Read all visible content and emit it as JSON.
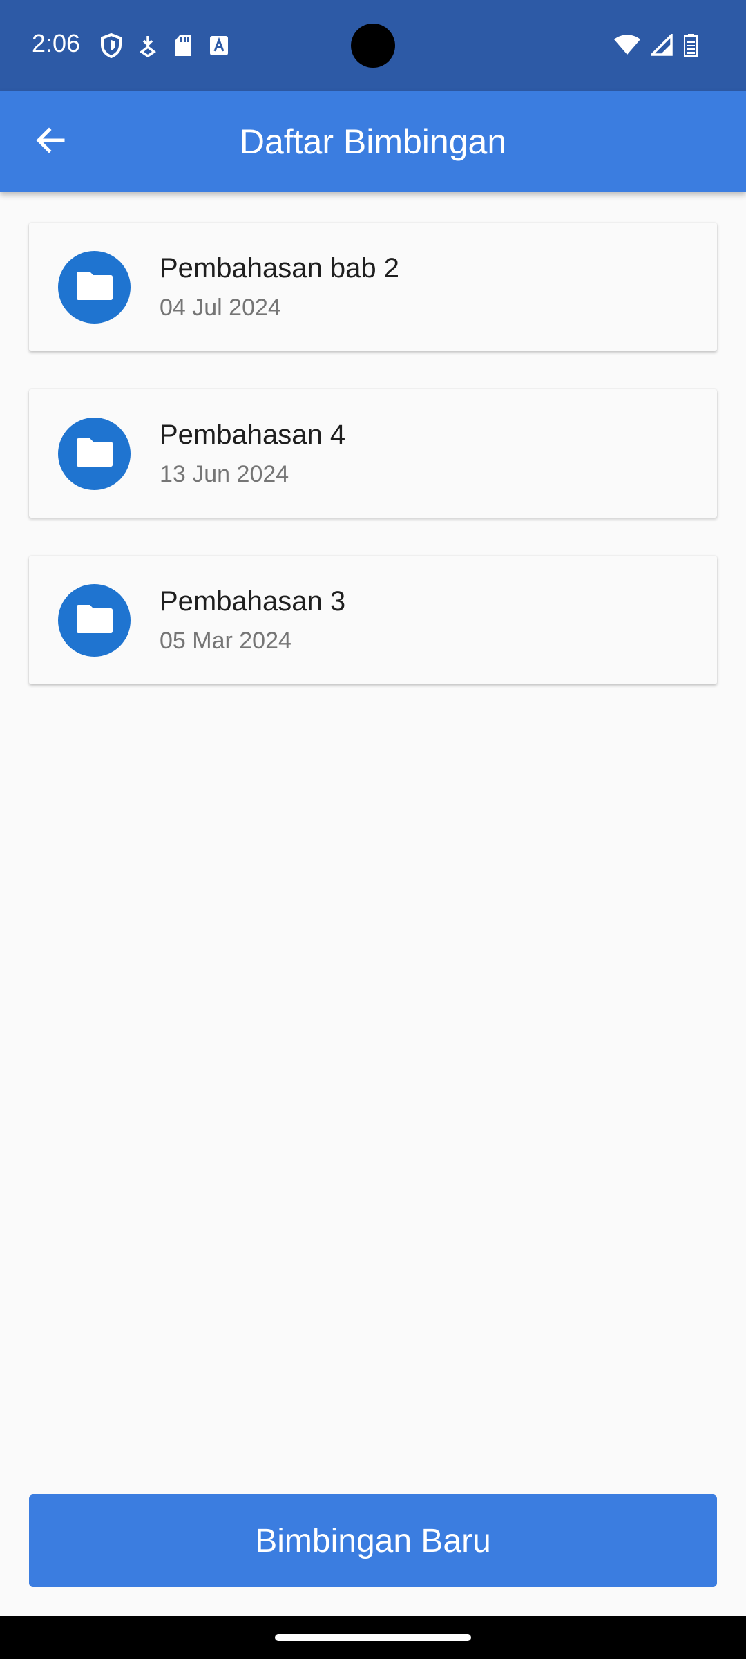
{
  "status_bar": {
    "time": "2:06",
    "left_icons": [
      "shield-icon",
      "download-icon",
      "sd-card-icon",
      "font-icon"
    ],
    "right_icons": [
      "wifi-icon",
      "signal-icon",
      "battery-icon"
    ]
  },
  "app_bar": {
    "back_icon": "arrow-back-icon",
    "title": "Daftar Bimbingan",
    "color": "#3b7de0"
  },
  "items": [
    {
      "title": "Pembahasan bab 2",
      "date": "04 Jul 2024",
      "icon": "folder-icon"
    },
    {
      "title": "Pembahasan 4",
      "date": "13 Jun 2024",
      "icon": "folder-icon"
    },
    {
      "title": "Pembahasan 3",
      "date": "05 Mar 2024",
      "icon": "folder-icon"
    }
  ],
  "new_button": {
    "label": "Bimbingan Baru"
  },
  "colors": {
    "status_bar": "#2d5aa6",
    "accent": "#3b7de0",
    "avatar": "#1f74d0",
    "background": "#fafafa"
  }
}
